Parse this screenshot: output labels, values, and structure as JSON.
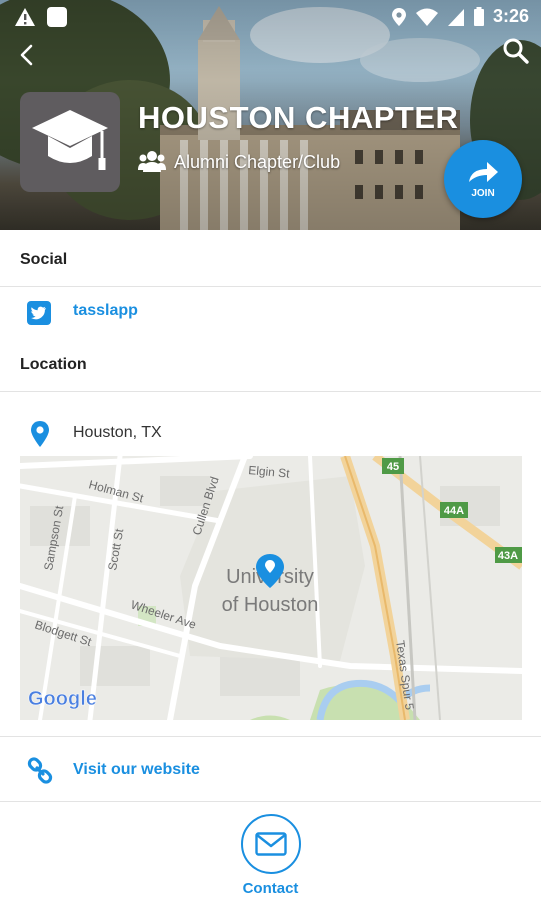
{
  "status_bar": {
    "time": "3:26"
  },
  "header": {
    "title": "HOUSTON CHAPTER",
    "subtitle": "Alumni Chapter/Club",
    "join_label": "JOIN"
  },
  "social": {
    "heading": "Social",
    "twitter_handle": "tasslapp"
  },
  "location": {
    "heading": "Location",
    "place": "Houston, TX",
    "map": {
      "streets": [
        "Elgin St",
        "Holman St",
        "Cullen Blvd",
        "Sampson St",
        "Scott St",
        "Wheeler Ave",
        "Blodgett St",
        "Texas Spur 5"
      ],
      "poi_line1": "University",
      "poi_line2": "of Houston",
      "highway_badges": [
        "45",
        "44A",
        "43A"
      ],
      "attribution": "Google"
    }
  },
  "website": {
    "label": "Visit our website"
  },
  "contact": {
    "label": "Contact"
  },
  "colors": {
    "accent": "#1a8fe0",
    "logo_bg": "#5f5c5f",
    "map_bg": "#ebebe7"
  }
}
